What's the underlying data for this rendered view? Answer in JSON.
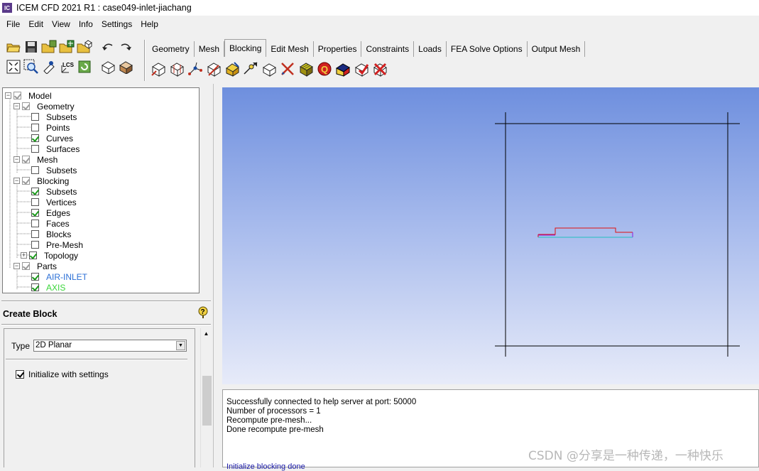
{
  "window": {
    "app_icon": "IC",
    "title": "ICEM CFD 2021 R1 : case049-inlet-jiachang"
  },
  "menu": [
    "File",
    "Edit",
    "View",
    "Info",
    "Settings",
    "Help"
  ],
  "tabs": [
    "Geometry",
    "Mesh",
    "Blocking",
    "Edit Mesh",
    "Properties",
    "Constraints",
    "Loads",
    "FEA Solve Options",
    "Output Mesh"
  ],
  "active_tab": "Blocking",
  "toolbar_icons": {
    "row1": [
      "open-icon",
      "save-icon",
      "open-geometry-icon",
      "save-geometry-icon",
      "open-blocking-icon",
      "undo-icon",
      "redo-icon"
    ],
    "row2": [
      "fit-window-icon",
      "zoom-box-icon",
      "measure-icon",
      "local-coordinate-icon",
      "refresh-icon",
      "wireframe-icon",
      "solid-icon"
    ]
  },
  "blocking_icons": [
    "create-block-icon",
    "split-block-icon",
    "merge-vertices-icon",
    "edit-block-icon",
    "associate-icon",
    "move-vertex-icon",
    "transform-blocks-icon",
    "edit-edge-icon",
    "pre-mesh-params-icon",
    "pre-mesh-quality-icon",
    "pre-mesh-smooth-icon",
    "check-blocks-icon",
    "delete-block-icon"
  ],
  "tree": [
    {
      "label": "Model",
      "level": 0,
      "expander": "minus",
      "check": "grey"
    },
    {
      "label": "Geometry",
      "level": 1,
      "expander": "minus",
      "check": "grey"
    },
    {
      "label": "Subsets",
      "level": 2,
      "expander": "",
      "check": "off"
    },
    {
      "label": "Points",
      "level": 2,
      "expander": "",
      "check": "off"
    },
    {
      "label": "Curves",
      "level": 2,
      "expander": "",
      "check": "on"
    },
    {
      "label": "Surfaces",
      "level": 2,
      "expander": "",
      "check": "off"
    },
    {
      "label": "Mesh",
      "level": 1,
      "expander": "minus",
      "check": "grey"
    },
    {
      "label": "Subsets",
      "level": 2,
      "expander": "",
      "check": "off"
    },
    {
      "label": "Blocking",
      "level": 1,
      "expander": "minus",
      "check": "grey"
    },
    {
      "label": "Subsets",
      "level": 2,
      "expander": "",
      "check": "on"
    },
    {
      "label": "Vertices",
      "level": 2,
      "expander": "",
      "check": "off"
    },
    {
      "label": "Edges",
      "level": 2,
      "expander": "",
      "check": "on"
    },
    {
      "label": "Faces",
      "level": 2,
      "expander": "",
      "check": "off"
    },
    {
      "label": "Blocks",
      "level": 2,
      "expander": "",
      "check": "off"
    },
    {
      "label": "Pre-Mesh",
      "level": 2,
      "expander": "",
      "check": "off"
    },
    {
      "label": "Topology",
      "level": 2,
      "expander": "plus",
      "check": "on"
    },
    {
      "label": "Parts",
      "level": 1,
      "expander": "minus",
      "check": "grey"
    },
    {
      "label": "AIR-INLET",
      "level": 2,
      "expander": "",
      "check": "on",
      "color": "#2b6fd6"
    },
    {
      "label": "AXIS",
      "level": 2,
      "expander": "",
      "check": "on",
      "color": "#3ad63a"
    }
  ],
  "panel": {
    "title": "Create Block",
    "type_label": "Type",
    "type_value": "2D Planar",
    "init_label": "Initialize with settings",
    "init_checked": true
  },
  "viewport": {
    "background_top": "#6e8fde",
    "background_bottom": "#e7ebf9",
    "geometry_colors": {
      "wall": "#e01010",
      "inlet": "#8a1ae0",
      "axis": "#20c0c0"
    }
  },
  "console": {
    "lines": [
      "Successfully connected to help server at port: 50000",
      "Number of processors = 1",
      "Recompute pre-mesh...",
      "Done recompute pre-mesh"
    ],
    "bottom_line": "Initialize blocking done"
  },
  "watermark": "CSDN @分享是一种传递，一种快乐"
}
